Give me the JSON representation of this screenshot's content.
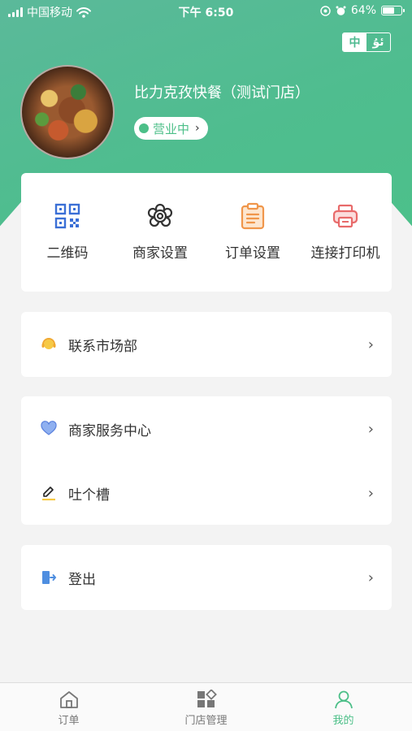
{
  "status_bar": {
    "carrier": "中国移动",
    "time": "下午 6:50",
    "battery_text": "64%",
    "battery_level": 0.64
  },
  "header": {
    "lang_primary": "中",
    "lang_secondary": "ئۇ",
    "store_name": "比力克孜快餐（测试门店）",
    "status_label": "营业中",
    "status_chevron": "›"
  },
  "quick_actions": [
    {
      "label": "二维码",
      "icon": "qr-code-icon",
      "color": "#3a6fd6"
    },
    {
      "label": "商家设置",
      "icon": "gear-flower-icon",
      "color": "#333333"
    },
    {
      "label": "订单设置",
      "icon": "clipboard-icon",
      "color": "#f0964a"
    },
    {
      "label": "连接打印机",
      "icon": "printer-icon",
      "color": "#e86a6a"
    }
  ],
  "menu": {
    "contact": {
      "label": "联系市场部",
      "icon": "headset-icon"
    },
    "service": {
      "label": "商家服务中心",
      "icon": "heart-icon"
    },
    "feedback": {
      "label": "吐个槽",
      "icon": "pencil-icon"
    },
    "logout": {
      "label": "登出",
      "icon": "exit-door-icon"
    },
    "chevron": "›"
  },
  "tabbar": {
    "tabs": [
      {
        "label": "订单",
        "icon": "home-icon",
        "active": false
      },
      {
        "label": "门店管理",
        "icon": "grid-icon",
        "active": false
      },
      {
        "label": "我的",
        "icon": "person-icon",
        "active": true
      }
    ],
    "active_color": "#4cbf88"
  }
}
